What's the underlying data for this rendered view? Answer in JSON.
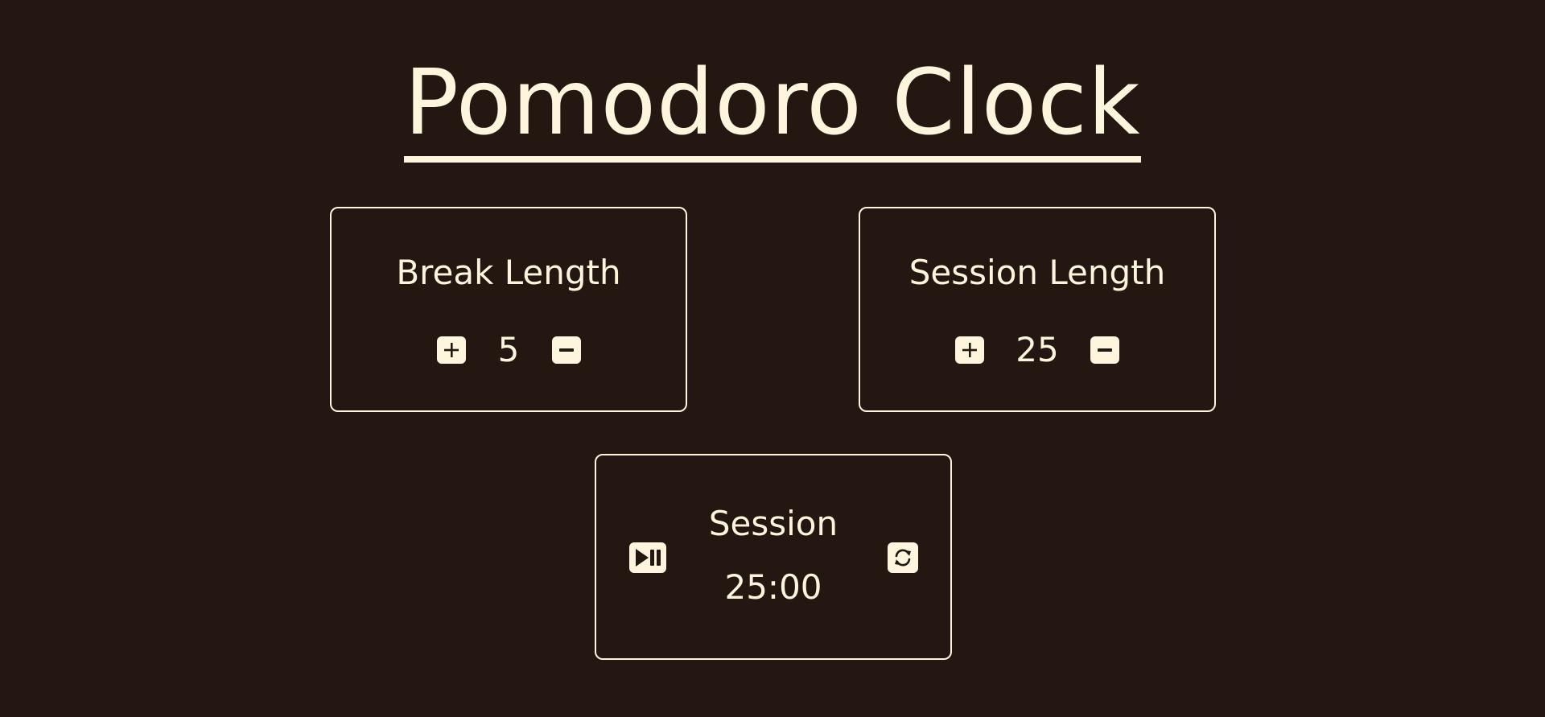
{
  "header": {
    "title": "Pomodoro Clock"
  },
  "break_card": {
    "label": "Break Length",
    "value": "5",
    "increment_icon": "plus-square-icon",
    "decrement_icon": "minus-square-icon"
  },
  "session_card": {
    "label": "Session Length",
    "value": "25",
    "increment_icon": "plus-square-icon",
    "decrement_icon": "minus-square-icon"
  },
  "timer_card": {
    "label": "Session",
    "time": "25:00",
    "play_pause_icon": "play-pause-icon",
    "reset_icon": "refresh-icon"
  },
  "colors": {
    "background": "#241712",
    "foreground": "#fdf6dc"
  }
}
